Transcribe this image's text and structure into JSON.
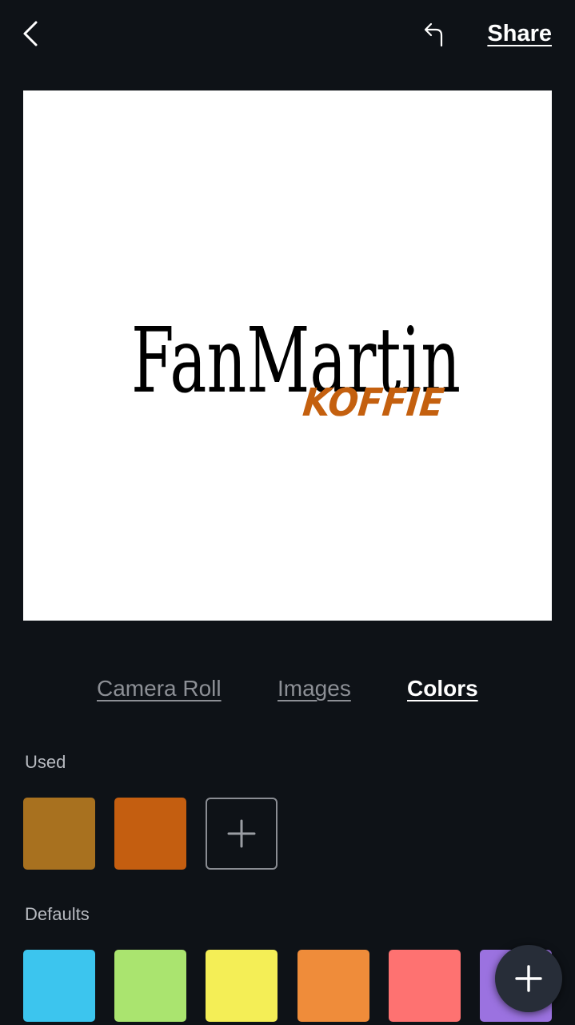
{
  "header": {
    "back_icon": "chevron-left-icon",
    "undo_icon": "undo-icon",
    "share_label": "Share"
  },
  "canvas": {
    "background": "#ffffff",
    "logo": {
      "title": "FanMartin",
      "subtitle": "KOFFIE",
      "title_color": "#000000",
      "subtitle_color": "#c4600f"
    }
  },
  "tabs": [
    {
      "label": "Camera Roll",
      "active": false
    },
    {
      "label": "Images",
      "active": false
    },
    {
      "label": "Colors",
      "active": true
    }
  ],
  "used": {
    "label": "Used",
    "colors": [
      "#a8711f",
      "#c45e10"
    ],
    "add_icon": "plus-icon"
  },
  "defaults": {
    "label": "Defaults",
    "colors": [
      "#3cc5ee",
      "#aae46f",
      "#f4ee56",
      "#ef8c3a",
      "#fe7271",
      "#9b72e0"
    ]
  },
  "fab": {
    "icon": "plus-icon",
    "color": "#272d38"
  }
}
